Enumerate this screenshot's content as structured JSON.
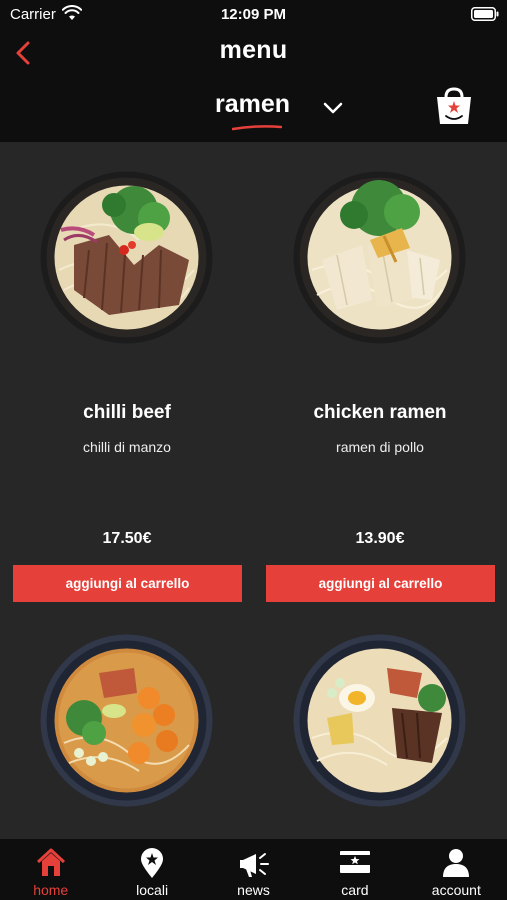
{
  "status_bar": {
    "carrier": "Carrier",
    "time": "12:09 PM"
  },
  "header": {
    "title": "menu",
    "category": "ramen"
  },
  "products": [
    {
      "name": "chilli beef",
      "description": "chilli di manzo",
      "price": "17.50€",
      "button_label": "aggiungi al carrello",
      "image": "chilli-beef-ramen-bowl"
    },
    {
      "name": "chicken ramen",
      "description": "ramen di pollo",
      "price": "13.90€",
      "button_label": "aggiungi al carrello",
      "image": "chicken-ramen-bowl"
    },
    {
      "name": "",
      "description": "",
      "price": "",
      "button_label": "",
      "image": "shrimp-ramen-bowl"
    },
    {
      "name": "",
      "description": "",
      "price": "",
      "button_label": "",
      "image": "egg-beef-ramen-bowl"
    }
  ],
  "tab_bar": {
    "items": [
      {
        "label": "home",
        "icon": "home-icon",
        "active": true
      },
      {
        "label": "locali",
        "icon": "location-pin-icon",
        "active": false
      },
      {
        "label": "news",
        "icon": "megaphone-icon",
        "active": false
      },
      {
        "label": "card",
        "icon": "card-icon",
        "active": false
      },
      {
        "label": "account",
        "icon": "user-icon",
        "active": false
      }
    ]
  },
  "colors": {
    "accent": "#e6403a",
    "background": "#272727",
    "bar": "#0e0e0e"
  }
}
